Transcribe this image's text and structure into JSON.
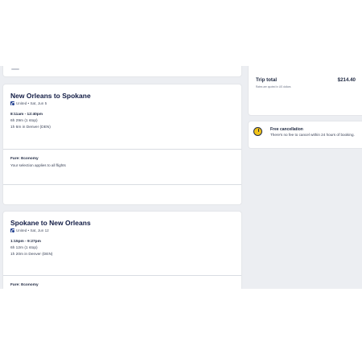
{
  "flights": [
    {
      "title": "New Orleans to Spokane",
      "airline_date": "United • Sat, Jun 5",
      "times": "8:11am - 12:40pm",
      "duration": "6h 29m (1 stop)",
      "layover": "1h 6m in Denver (DEN)",
      "fare": "Fare: Economy",
      "fare_note": "Your selection applies to all flights"
    },
    {
      "title": "Spokane to New Orleans",
      "airline_date": "United • Sat, Jun 12",
      "times": "1:15pm - 9:27pm",
      "duration": "6h 12m (1 stop)",
      "layover": "1h 20m in Denver (DEN)",
      "fare": "Fare: Economy"
    }
  ],
  "summary": {
    "label": "Trip total",
    "total": "$214.40",
    "note": "Rates are quoted in US dollars"
  },
  "cancellation": {
    "title": "Free cancellation",
    "text": "There's no fee to cancel within 24 hours of booking."
  },
  "icons": {
    "airline": "united-logo-icon",
    "cancellation": "clock-badge-icon"
  },
  "colors": {
    "page_bg": "#eceef2",
    "card_bg": "#ffffff",
    "heading": "#111b44",
    "badge": "#f2c318"
  }
}
